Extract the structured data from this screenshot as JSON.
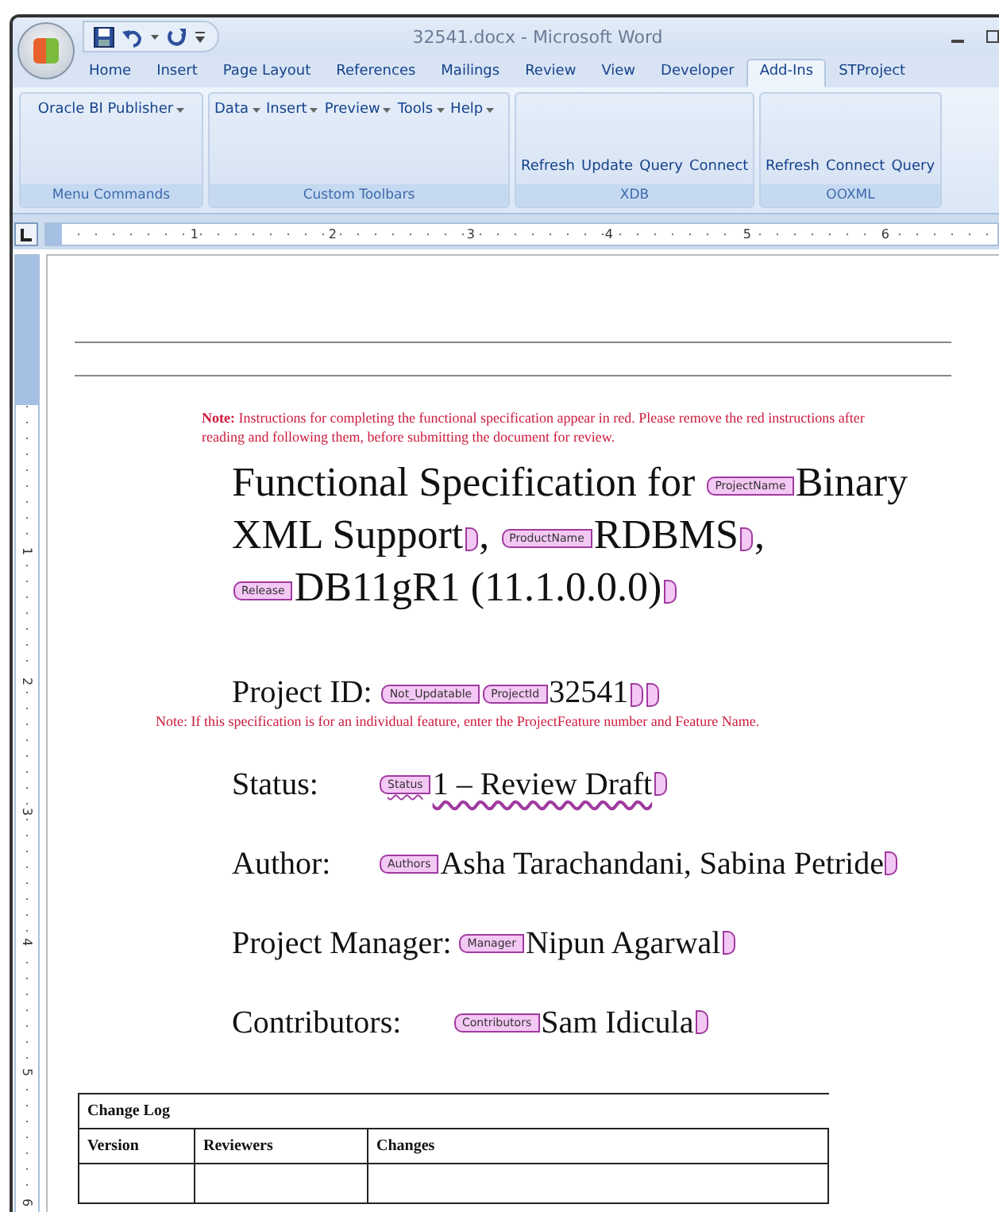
{
  "window": {
    "title": "32541.docx - Microsoft Word"
  },
  "tabs": [
    {
      "label": "Home",
      "selected": false
    },
    {
      "label": "Insert",
      "selected": false
    },
    {
      "label": "Page Layout",
      "selected": false
    },
    {
      "label": "References",
      "selected": false
    },
    {
      "label": "Mailings",
      "selected": false
    },
    {
      "label": "Review",
      "selected": false
    },
    {
      "label": "View",
      "selected": false
    },
    {
      "label": "Developer",
      "selected": false
    },
    {
      "label": "Add-Ins",
      "selected": true
    },
    {
      "label": "STProject",
      "selected": false
    }
  ],
  "ribbon_groups": [
    {
      "name": "Menu Commands",
      "kind": "menus",
      "items": [
        "Oracle BI Publisher"
      ]
    },
    {
      "name": "Custom Toolbars",
      "kind": "menus",
      "items": [
        "Data",
        "Insert",
        "Preview",
        "Tools",
        "Help"
      ]
    },
    {
      "name": "XDB",
      "kind": "buttons",
      "items": [
        "Refresh",
        "Update",
        "Query",
        "Connect"
      ]
    },
    {
      "name": "OOXML",
      "kind": "buttons",
      "items": [
        "Refresh",
        "Connect",
        "Query"
      ]
    }
  ],
  "ruler": {
    "horizontal": [
      "1",
      "2",
      "3",
      "4",
      "5",
      "6"
    ],
    "vertical": [
      "1",
      "2",
      "3",
      "4",
      "5",
      "6"
    ]
  },
  "document": {
    "note": "**Note:** Instructions for completing the functional specification appear in red.  Please remove the red instructions after reading and following them, before submitting the document for review.",
    "title": [
      {
        "kind": "text",
        "text": "Functional Specification for "
      },
      {
        "kind": "tag",
        "text": "ProjectName"
      },
      {
        "kind": "text",
        "text": "Binary"
      },
      {
        "kind": "text",
        "text": "XML Support"
      },
      {
        "kind": "close"
      },
      {
        "kind": "text",
        "text": ", "
      },
      {
        "kind": "tag",
        "text": "ProductName"
      },
      {
        "kind": "text",
        "text": "RDBMS"
      },
      {
        "kind": "close"
      },
      {
        "kind": "text",
        "text": ", "
      },
      {
        "kind": "tag",
        "text": "Release"
      },
      {
        "kind": "text",
        "text": "DB11gR1 (11.1.0.0.0)"
      },
      {
        "kind": "close"
      }
    ],
    "project_id": [
      {
        "kind": "text",
        "text": "Project ID: "
      },
      {
        "kind": "tag",
        "text": "Not_Updatable"
      },
      {
        "kind": "tag",
        "text": "ProjectId"
      },
      {
        "kind": "text",
        "text": "32541"
      },
      {
        "kind": "close"
      },
      {
        "kind": "close"
      }
    ],
    "feature_note": "Note: If this specification is  for an individual feature, enter the ProjectFeature number and Feature Name.",
    "fields": [
      {
        "label": "Status:",
        "tag": "Status",
        "value": "1 – Review Draft",
        "spell_flagged": true
      },
      {
        "label": "Author:",
        "tag": "Authors",
        "value": "Asha Tarachandani, Sabina Petride",
        "spell_flagged": false
      },
      {
        "label": "Project Manager:",
        "tag": "Manager",
        "value": "Nipun Agarwal",
        "spell_flagged": false
      },
      {
        "label": "Contributors:",
        "tag": "Contributors",
        "value": "Sam Idicula",
        "spell_flagged": false
      }
    ],
    "change_log": {
      "title": "Change Log",
      "columns": [
        "Version",
        "Reviewers",
        "Changes"
      ],
      "rows": [
        [
          "",
          "",
          ""
        ]
      ]
    }
  }
}
